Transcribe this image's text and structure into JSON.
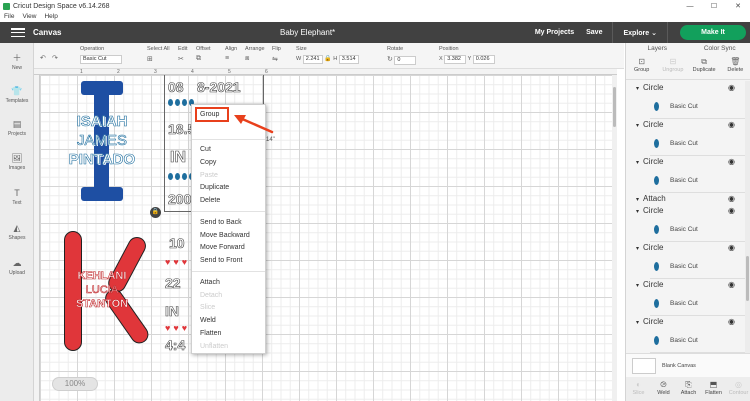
{
  "window": {
    "title": "Cricut Design Space  v6.14.268",
    "controls": [
      "—",
      "☐",
      "✕"
    ]
  },
  "menubar": [
    "File",
    "View",
    "Help"
  ],
  "header": {
    "section": "Canvas",
    "document_title": "Baby Elephant*",
    "my_projects": "My Projects",
    "save": "Save",
    "explore": "Explore",
    "make_it": "Make It"
  },
  "toolbar": {
    "operation_label": "Operation",
    "operation_value": "Basic Cut",
    "select_all_label": "Select All",
    "edit_label": "Edit",
    "offset_label": "Offset",
    "align_label": "Align",
    "arrange_label": "Arrange",
    "flip_label": "Flip",
    "size_label": "Size",
    "size_w_label": "W",
    "size_w": "2.241",
    "size_h_label": "H",
    "size_h": "3.514",
    "rotate_label": "Rotate",
    "rotate_value": "0",
    "position_label": "Position",
    "pos_x_label": "X",
    "pos_x": "3.382",
    "pos_y_label": "Y",
    "pos_y": "0.026"
  },
  "leftbar": [
    "New",
    "Templates",
    "Projects",
    "Images",
    "Text",
    "Shapes",
    "Upload"
  ],
  "ruler": [
    "1",
    "2",
    "3",
    "4",
    "5",
    "6"
  ],
  "artwork": {
    "name1": [
      "ISAIAH",
      "JAMES",
      "PINTADO"
    ],
    "name2": [
      "KEHLANI",
      "LUCIA",
      "STANTON"
    ],
    "date_top": "08",
    "date_year": "8-2021",
    "weight": "18.5",
    "in_text": "IN",
    "num_200": "200",
    "date2": "10",
    "num_22": "22",
    "in2": "IN",
    "num_4": "4:4",
    "dim_label": "14\""
  },
  "zoom": "100%",
  "context_menu": {
    "group": "Group",
    "cut": "Cut",
    "copy": "Copy",
    "paste": "Paste",
    "duplicate": "Duplicate",
    "delete": "Delete",
    "send_to_back": "Send to Back",
    "move_backward": "Move Backward",
    "move_forward": "Move Forward",
    "send_to_front": "Send to Front",
    "attach": "Attach",
    "detach": "Detach",
    "slice": "Slice",
    "weld": "Weld",
    "flatten": "Flatten",
    "unflatten": "Unflatten"
  },
  "right_panel": {
    "tabs": [
      "Layers",
      "Color Sync"
    ],
    "tools": [
      {
        "label": "Group",
        "icon": "group-icon",
        "enabled": true
      },
      {
        "label": "Ungroup",
        "icon": "ungroup-icon",
        "enabled": false
      },
      {
        "label": "Duplicate",
        "icon": "duplicate-icon",
        "enabled": true
      },
      {
        "label": "Delete",
        "icon": "trash-icon",
        "enabled": true
      }
    ],
    "layers": [
      {
        "type": "group",
        "name": "Circle"
      },
      {
        "type": "item",
        "name": "Basic Cut"
      },
      {
        "type": "group",
        "name": "Circle"
      },
      {
        "type": "item",
        "name": "Basic Cut"
      },
      {
        "type": "group",
        "name": "Circle"
      },
      {
        "type": "item",
        "name": "Basic Cut"
      },
      {
        "type": "group",
        "name": "Attach"
      },
      {
        "type": "group",
        "name": "Circle"
      },
      {
        "type": "item",
        "name": "Basic Cut"
      },
      {
        "type": "group",
        "name": "Circle"
      },
      {
        "type": "item",
        "name": "Basic Cut"
      },
      {
        "type": "group",
        "name": "Circle"
      },
      {
        "type": "item",
        "name": "Basic Cut"
      },
      {
        "type": "group",
        "name": "Circle"
      },
      {
        "type": "item",
        "name": "Basic Cut"
      }
    ],
    "blank_canvas": "Blank Canvas",
    "footer": [
      {
        "label": "Slice",
        "enabled": false
      },
      {
        "label": "Weld",
        "enabled": true
      },
      {
        "label": "Attach",
        "enabled": true
      },
      {
        "label": "Flatten",
        "enabled": true
      },
      {
        "label": "Contour",
        "enabled": false
      }
    ]
  },
  "colors": {
    "header": "#414141",
    "make_it": "#12a05c",
    "highlight": "#e8401c",
    "blue_art": "#1e4fa3",
    "teal_art": "#1e6e9e",
    "red_art": "#e0363a"
  }
}
